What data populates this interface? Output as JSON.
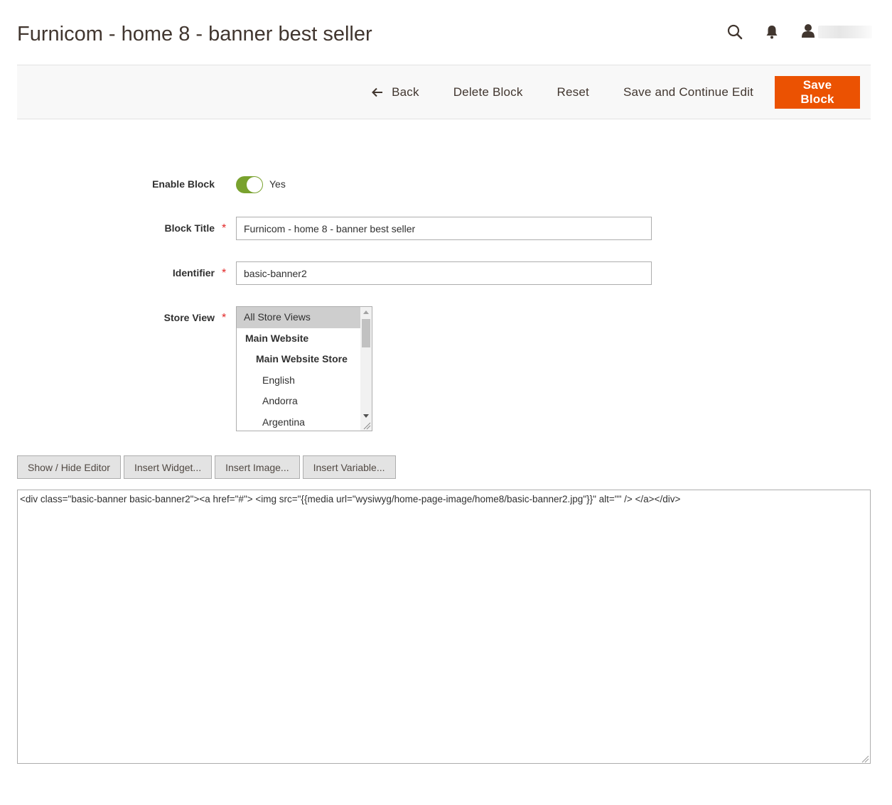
{
  "header": {
    "title": "Furnicom - home 8 - banner best seller",
    "icons": [
      "search-icon",
      "bell-icon",
      "user-icon"
    ],
    "user_name": ""
  },
  "actions": {
    "back_label": "Back",
    "delete_label": "Delete Block",
    "reset_label": "Reset",
    "save_continue_label": "Save and Continue Edit",
    "save_label": "Save Block",
    "primary_color": "#eb5202"
  },
  "form": {
    "enable_block": {
      "label": "Enable Block",
      "value": true,
      "value_label": "Yes",
      "toggle_color": "#79a22e"
    },
    "block_title": {
      "label": "Block Title",
      "required": "*",
      "value": "Furnicom - home 8 - banner best seller"
    },
    "identifier": {
      "label": "Identifier",
      "required": "*",
      "value": "basic-banner2"
    },
    "store_view": {
      "label": "Store View",
      "required": "*",
      "options": [
        {
          "label": "All Store Views",
          "selected": true
        },
        {
          "label": "Main Website",
          "selected": false
        },
        {
          "label": "Main Website Store",
          "selected": false
        },
        {
          "label": "English",
          "selected": false
        },
        {
          "label": "Andorra",
          "selected": false
        },
        {
          "label": "Argentina",
          "selected": false
        }
      ]
    }
  },
  "editor": {
    "buttons": {
      "show_hide": "Show / Hide Editor",
      "insert_widget": "Insert Widget...",
      "insert_image": "Insert Image...",
      "insert_variable": "Insert Variable..."
    },
    "content": "<div class=\"basic-banner basic-banner2\"><a href=\"#\"> <img src=\"{{media url=\"wysiwyg/home-page-image/home8/basic-banner2.jpg\"}}\" alt=\"\" /> </a></div>"
  }
}
